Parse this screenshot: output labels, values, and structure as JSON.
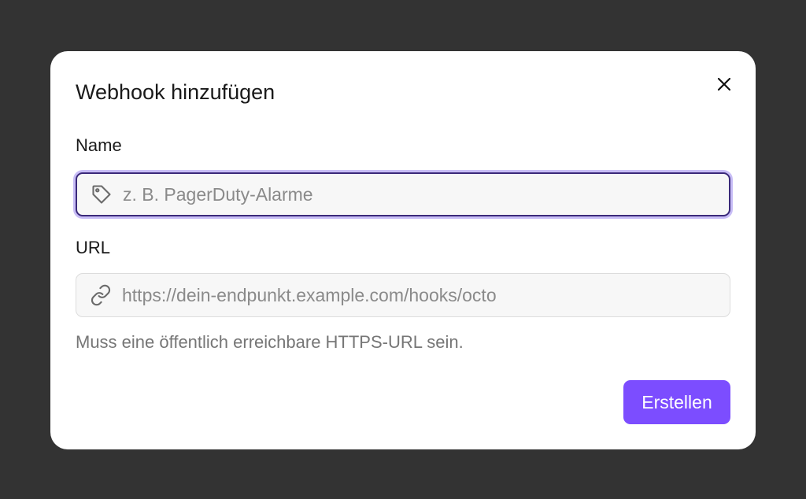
{
  "dialog": {
    "title": "Webhook hinzufügen",
    "close_icon": "close-icon",
    "name_field": {
      "label": "Name",
      "placeholder": "z. B. PagerDuty-Alarme",
      "value": "",
      "icon": "tag-icon"
    },
    "url_field": {
      "label": "URL",
      "placeholder": "https://dein-endpunkt.example.com/hooks/octo",
      "value": "",
      "icon": "link-icon",
      "helper": "Muss eine öffentlich erreichbare HTTPS-URL sein."
    },
    "submit_label": "Erstellen"
  },
  "colors": {
    "backdrop": "#333333",
    "dialog_bg": "#ffffff",
    "accent": "#7c4dff",
    "focus_border": "#3b2a7a",
    "focus_ring": "#c8bdf6",
    "helper_text": "#767676"
  }
}
